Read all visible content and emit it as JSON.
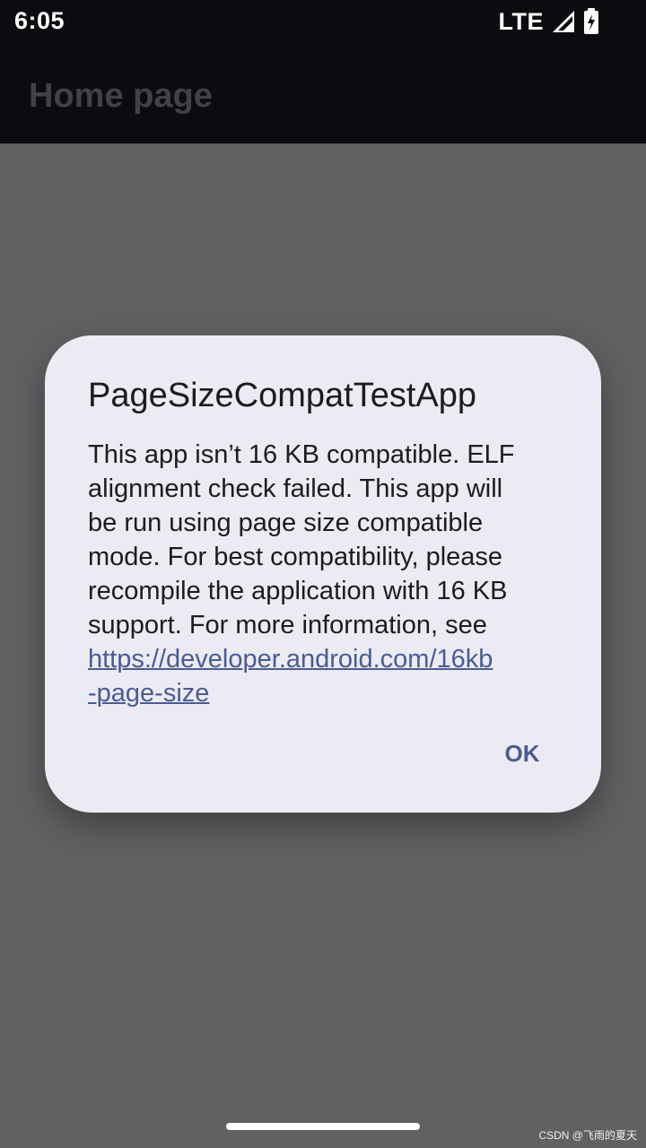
{
  "status_bar": {
    "time": "6:05",
    "network": "LTE",
    "icons": [
      "signal-icon",
      "battery-charging-icon"
    ]
  },
  "app_bar": {
    "title": "Home page"
  },
  "dialog": {
    "title": "PageSizeCompatTestApp",
    "message": "This app isn’t 16 KB compatible. ELF\nalignment check failed. This app will\nbe run using page size compatible\nmode. For best compatibility, please\nrecompile the application with 16 KB\nsupport. For more information, see\n",
    "link": "https://developer.android.com/16kb\n-page-size",
    "ok_label": "OK"
  },
  "watermark": "CSDN @飞雨的夏天",
  "colors": {
    "status_bar_background": "#0b0c0f",
    "scrim": "#616163",
    "dialog_background": "#ecebf3",
    "accent": "#4a5c92",
    "text_primary": "#1b1b21"
  }
}
